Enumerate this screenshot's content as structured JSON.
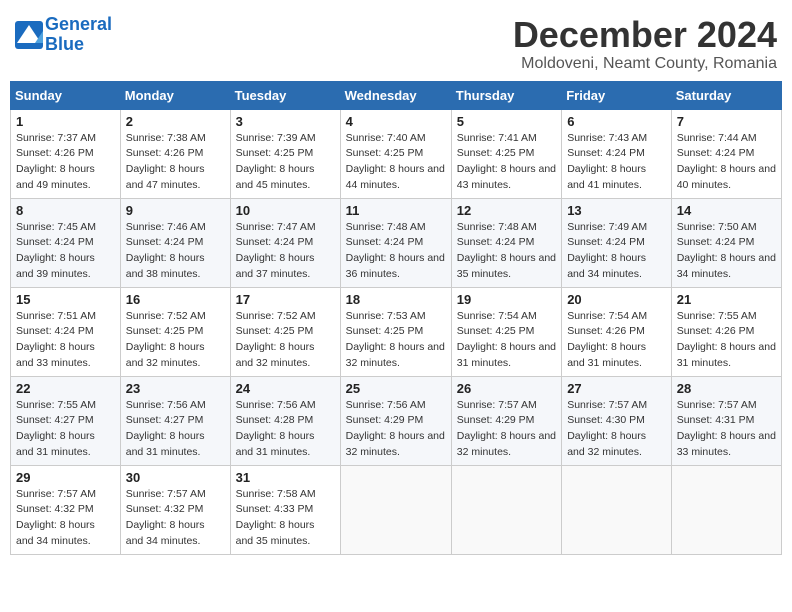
{
  "header": {
    "logo_line1": "General",
    "logo_line2": "Blue",
    "month_year": "December 2024",
    "location": "Moldoveni, Neamt County, Romania"
  },
  "weekdays": [
    "Sunday",
    "Monday",
    "Tuesday",
    "Wednesday",
    "Thursday",
    "Friday",
    "Saturday"
  ],
  "weeks": [
    [
      {
        "day": "1",
        "sunrise": "7:37 AM",
        "sunset": "4:26 PM",
        "daylight": "8 hours and 49 minutes."
      },
      {
        "day": "2",
        "sunrise": "7:38 AM",
        "sunset": "4:26 PM",
        "daylight": "8 hours and 47 minutes."
      },
      {
        "day": "3",
        "sunrise": "7:39 AM",
        "sunset": "4:25 PM",
        "daylight": "8 hours and 45 minutes."
      },
      {
        "day": "4",
        "sunrise": "7:40 AM",
        "sunset": "4:25 PM",
        "daylight": "8 hours and 44 minutes."
      },
      {
        "day": "5",
        "sunrise": "7:41 AM",
        "sunset": "4:25 PM",
        "daylight": "8 hours and 43 minutes."
      },
      {
        "day": "6",
        "sunrise": "7:43 AM",
        "sunset": "4:24 PM",
        "daylight": "8 hours and 41 minutes."
      },
      {
        "day": "7",
        "sunrise": "7:44 AM",
        "sunset": "4:24 PM",
        "daylight": "8 hours and 40 minutes."
      }
    ],
    [
      {
        "day": "8",
        "sunrise": "7:45 AM",
        "sunset": "4:24 PM",
        "daylight": "8 hours and 39 minutes."
      },
      {
        "day": "9",
        "sunrise": "7:46 AM",
        "sunset": "4:24 PM",
        "daylight": "8 hours and 38 minutes."
      },
      {
        "day": "10",
        "sunrise": "7:47 AM",
        "sunset": "4:24 PM",
        "daylight": "8 hours and 37 minutes."
      },
      {
        "day": "11",
        "sunrise": "7:48 AM",
        "sunset": "4:24 PM",
        "daylight": "8 hours and 36 minutes."
      },
      {
        "day": "12",
        "sunrise": "7:48 AM",
        "sunset": "4:24 PM",
        "daylight": "8 hours and 35 minutes."
      },
      {
        "day": "13",
        "sunrise": "7:49 AM",
        "sunset": "4:24 PM",
        "daylight": "8 hours and 34 minutes."
      },
      {
        "day": "14",
        "sunrise": "7:50 AM",
        "sunset": "4:24 PM",
        "daylight": "8 hours and 34 minutes."
      }
    ],
    [
      {
        "day": "15",
        "sunrise": "7:51 AM",
        "sunset": "4:24 PM",
        "daylight": "8 hours and 33 minutes."
      },
      {
        "day": "16",
        "sunrise": "7:52 AM",
        "sunset": "4:25 PM",
        "daylight": "8 hours and 32 minutes."
      },
      {
        "day": "17",
        "sunrise": "7:52 AM",
        "sunset": "4:25 PM",
        "daylight": "8 hours and 32 minutes."
      },
      {
        "day": "18",
        "sunrise": "7:53 AM",
        "sunset": "4:25 PM",
        "daylight": "8 hours and 32 minutes."
      },
      {
        "day": "19",
        "sunrise": "7:54 AM",
        "sunset": "4:25 PM",
        "daylight": "8 hours and 31 minutes."
      },
      {
        "day": "20",
        "sunrise": "7:54 AM",
        "sunset": "4:26 PM",
        "daylight": "8 hours and 31 minutes."
      },
      {
        "day": "21",
        "sunrise": "7:55 AM",
        "sunset": "4:26 PM",
        "daylight": "8 hours and 31 minutes."
      }
    ],
    [
      {
        "day": "22",
        "sunrise": "7:55 AM",
        "sunset": "4:27 PM",
        "daylight": "8 hours and 31 minutes."
      },
      {
        "day": "23",
        "sunrise": "7:56 AM",
        "sunset": "4:27 PM",
        "daylight": "8 hours and 31 minutes."
      },
      {
        "day": "24",
        "sunrise": "7:56 AM",
        "sunset": "4:28 PM",
        "daylight": "8 hours and 31 minutes."
      },
      {
        "day": "25",
        "sunrise": "7:56 AM",
        "sunset": "4:29 PM",
        "daylight": "8 hours and 32 minutes."
      },
      {
        "day": "26",
        "sunrise": "7:57 AM",
        "sunset": "4:29 PM",
        "daylight": "8 hours and 32 minutes."
      },
      {
        "day": "27",
        "sunrise": "7:57 AM",
        "sunset": "4:30 PM",
        "daylight": "8 hours and 32 minutes."
      },
      {
        "day": "28",
        "sunrise": "7:57 AM",
        "sunset": "4:31 PM",
        "daylight": "8 hours and 33 minutes."
      }
    ],
    [
      {
        "day": "29",
        "sunrise": "7:57 AM",
        "sunset": "4:32 PM",
        "daylight": "8 hours and 34 minutes."
      },
      {
        "day": "30",
        "sunrise": "7:57 AM",
        "sunset": "4:32 PM",
        "daylight": "8 hours and 34 minutes."
      },
      {
        "day": "31",
        "sunrise": "7:58 AM",
        "sunset": "4:33 PM",
        "daylight": "8 hours and 35 minutes."
      },
      null,
      null,
      null,
      null
    ]
  ]
}
